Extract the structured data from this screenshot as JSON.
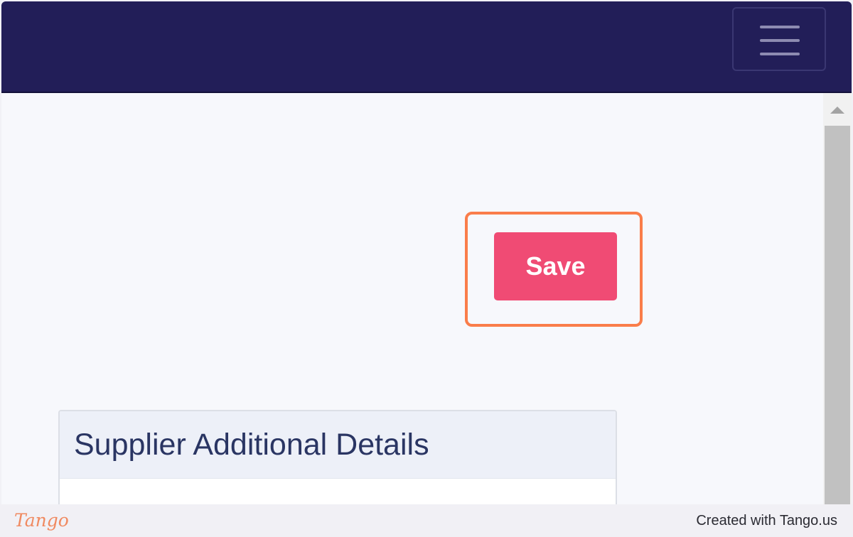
{
  "header": {
    "menu_icon": "hamburger-menu-icon",
    "background_color": "#221e58"
  },
  "main": {
    "save_button": {
      "label": "Save",
      "color": "#f04b74",
      "highlight_color": "#fa7d4a"
    },
    "card": {
      "title": "Supplier Additional Details"
    }
  },
  "scrollbar": {
    "up_icon": "scroll-up-arrow-icon"
  },
  "footer": {
    "logo_text": "Tango",
    "credit_text": "Created with Tango.us"
  }
}
